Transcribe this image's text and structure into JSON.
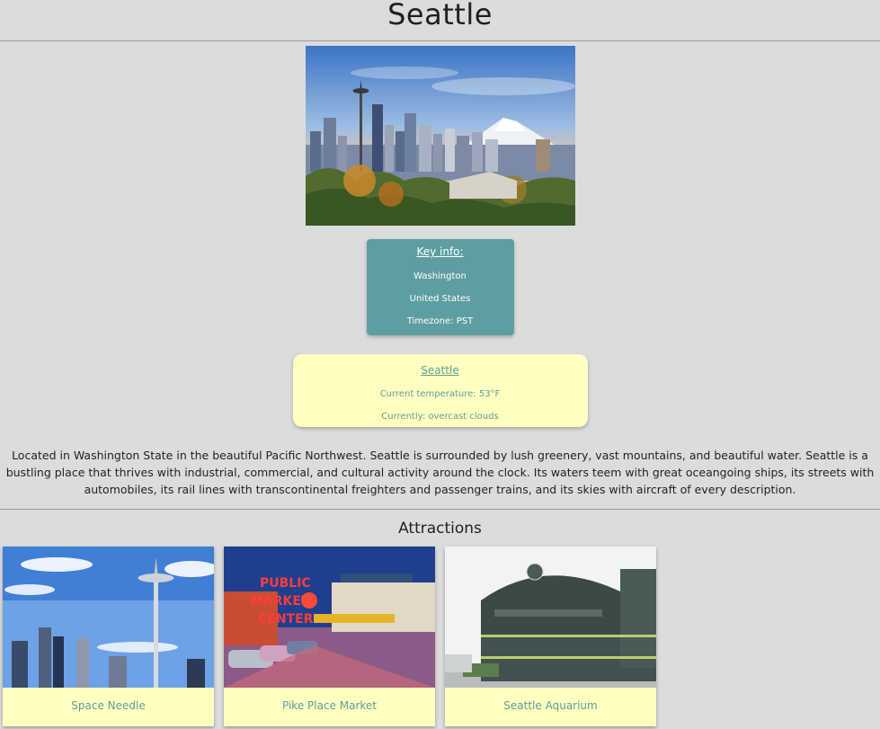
{
  "page": {
    "title": "Seattle"
  },
  "key_info": {
    "heading": "Key info:",
    "state": "Washington",
    "country": "United States",
    "timezone": "Timezone: PST"
  },
  "weather": {
    "city_link": "Seattle",
    "temperature": "Current temperature: 53°F",
    "conditions": "Currently: overcast clouds"
  },
  "description": "Located in Washington State in the beautiful Pacific Northwest. Seattle is surrounded by lush greenery, vast mountains, and beautiful water. Seattle is a bustling place that thrives with industrial, commercial, and cultural activity around the clock. Its waters teem with great oceangoing ships, its streets with automobiles, its rail lines with transcontinental freighters and passenger trains, and its skies with aircraft of every description.",
  "attractions": {
    "heading": "Attractions",
    "items": [
      {
        "label": "Space Needle"
      },
      {
        "label": "Pike Place Market"
      },
      {
        "label": "Seattle Aquarium"
      }
    ]
  },
  "colors": {
    "background": "#dcdcdc",
    "accent_teal": "#5f9ea0",
    "card_yellow": "#ffffc0"
  }
}
